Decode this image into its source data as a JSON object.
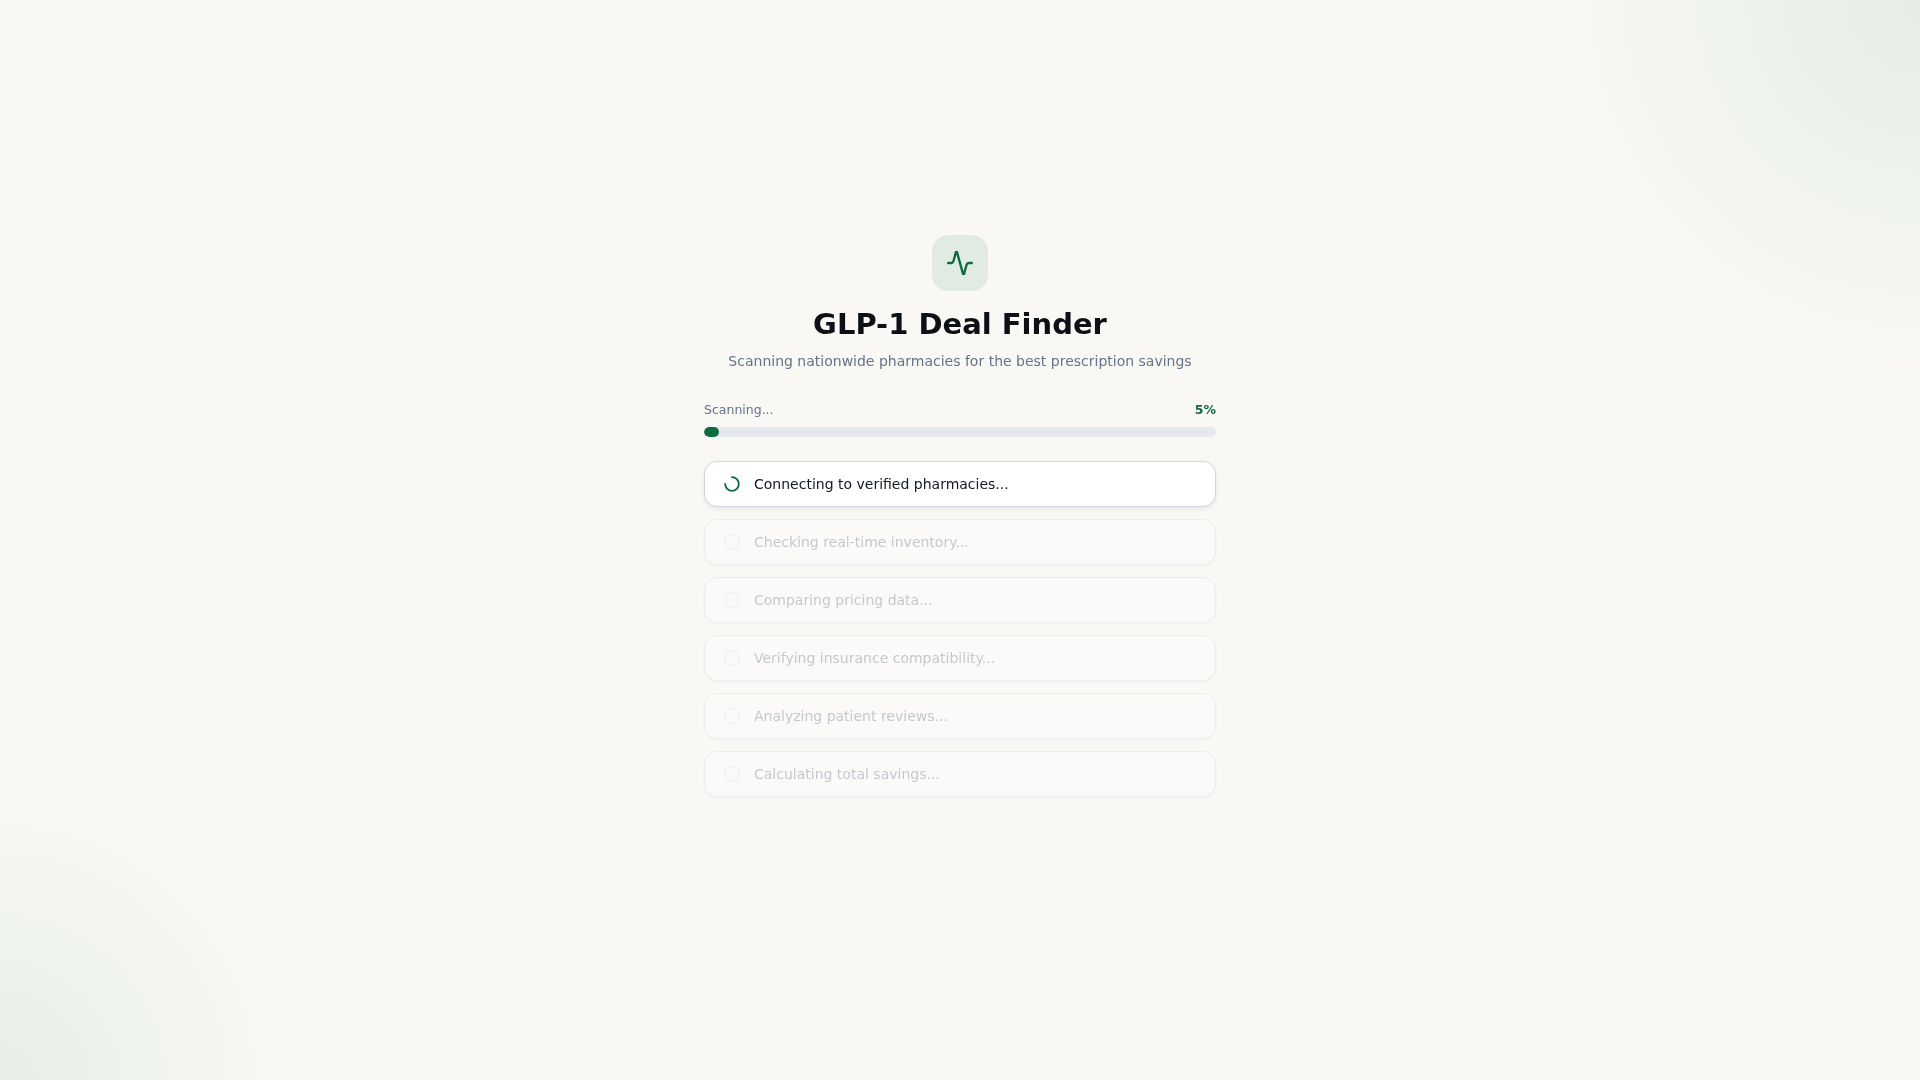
{
  "header": {
    "title": "GLP-1 Deal Finder",
    "subtitle": "Scanning nationwide pharmacies for the best prescription savings"
  },
  "progress": {
    "label": "Scanning...",
    "reading": "5%",
    "level": 0.03
  },
  "steps": [
    {
      "label": "Connecting to verified pharmacies...",
      "active": true
    },
    {
      "label": "Checking real-time inventory...",
      "active": false
    },
    {
      "label": "Comparing pricing data...",
      "active": false
    },
    {
      "label": "Verifying insurance compatibility...",
      "active": false
    },
    {
      "label": "Analyzing patient reviews...",
      "active": false
    },
    {
      "label": "Calculating total savings...",
      "active": false
    }
  ]
}
